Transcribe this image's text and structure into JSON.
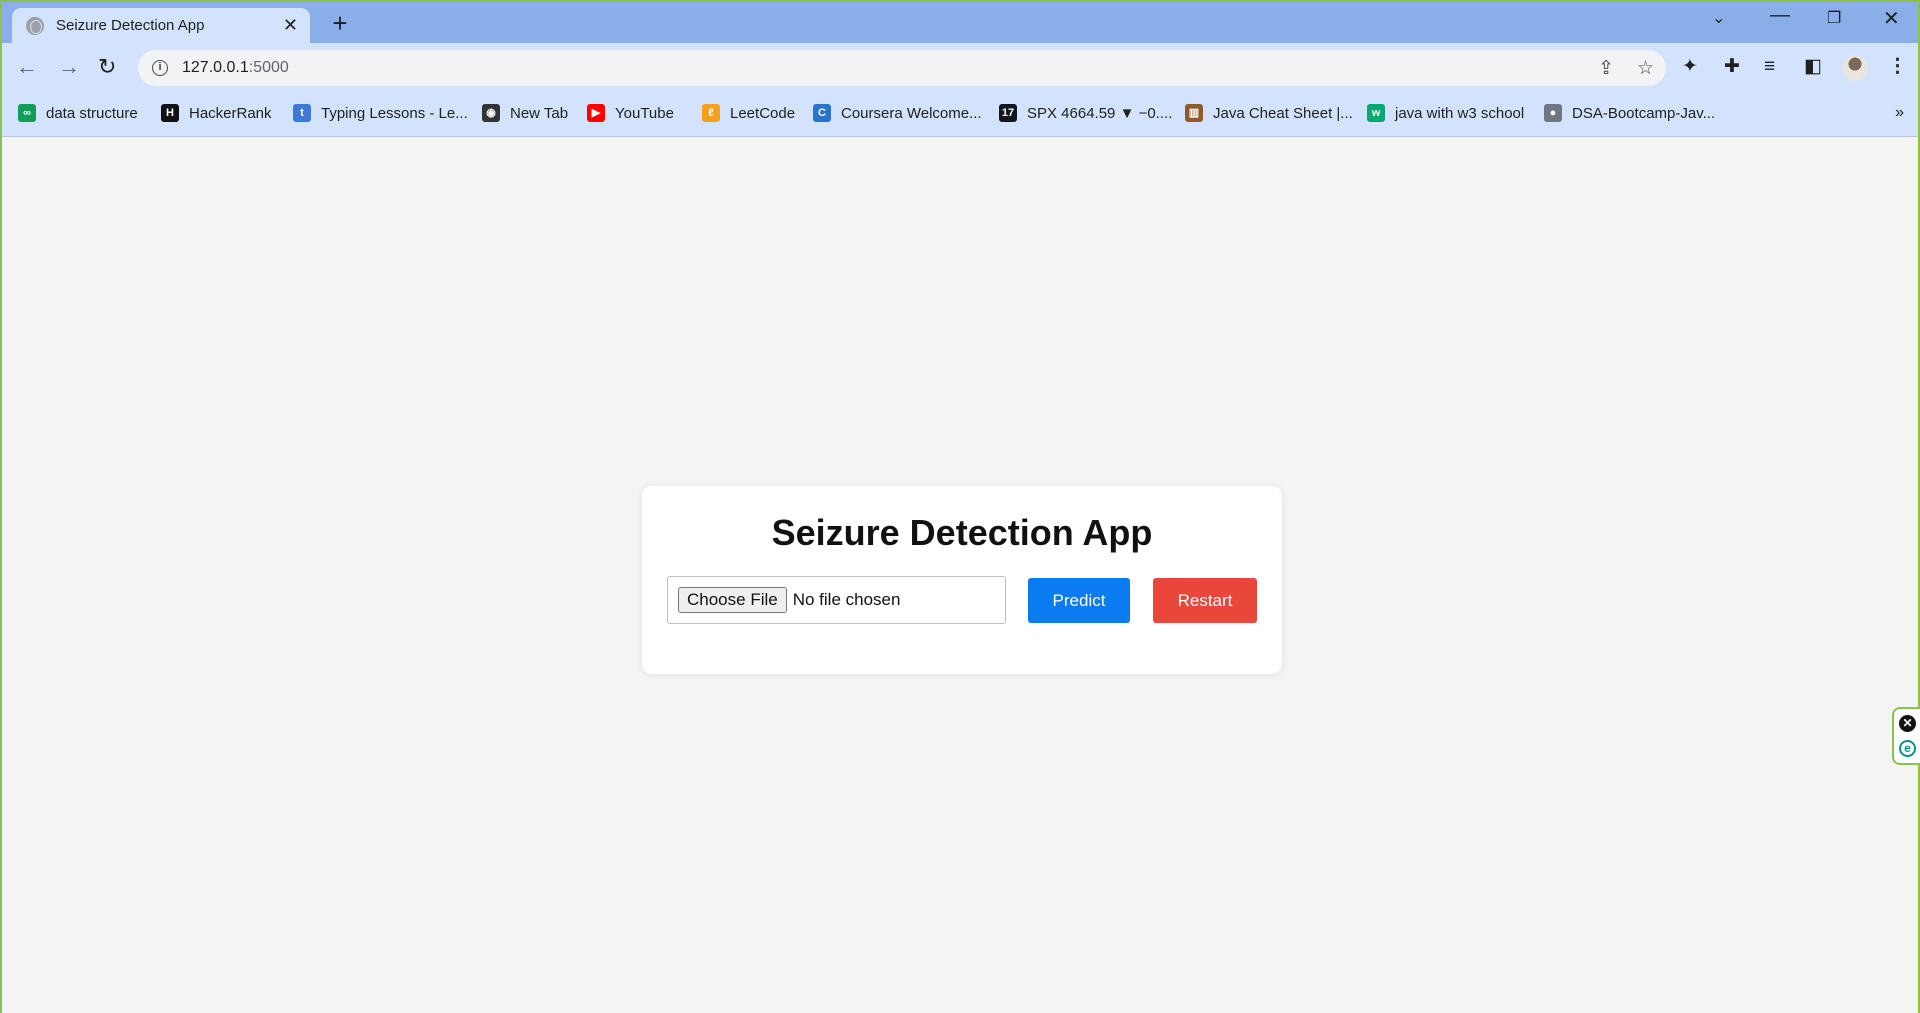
{
  "browser": {
    "tab": {
      "title": "Seizure Detection App",
      "close": "✕"
    },
    "new_tab": "+",
    "window": {
      "tab_search": "⌄",
      "minimize": "—",
      "maximize": "❐",
      "close": "✕"
    },
    "nav": {
      "back": "←",
      "forward": "→",
      "reload": "↻"
    },
    "address": {
      "host": "127.0.0.1",
      "port": ":5000",
      "info": "i"
    },
    "omnibox_icons": {
      "share": "⇪",
      "star": "☆"
    },
    "toolbar_icons": {
      "ext1": "✦",
      "ext2": "✚",
      "media": "≡",
      "side_panel": "◧",
      "menu": "⋮"
    },
    "bookmarks": [
      {
        "label": "data structure",
        "icon": "link-icon",
        "color": "#0f9d58",
        "glyph": "∞"
      },
      {
        "label": "HackerRank",
        "icon": "hackerrank-icon",
        "color": "#111111",
        "glyph": "H"
      },
      {
        "label": "Typing Lessons - Le...",
        "icon": "typing-icon",
        "color": "#3d7ad6",
        "glyph": "t"
      },
      {
        "label": "New Tab",
        "icon": "globe-icon",
        "color": "#333333",
        "glyph": "◉"
      },
      {
        "label": "YouTube",
        "icon": "youtube-icon",
        "color": "#ff0000",
        "glyph": "▶"
      },
      {
        "label": "LeetCode",
        "icon": "leetcode-icon",
        "color": "#f89f1b",
        "glyph": "ℓ"
      },
      {
        "label": "Coursera Welcome...",
        "icon": "coursera-icon",
        "color": "#2a73cc",
        "glyph": "C"
      },
      {
        "label": "SPX 4664.59 ▼ −0....",
        "icon": "tradingview-icon",
        "color": "#131722",
        "glyph": "17"
      },
      {
        "label": "Java Cheat Sheet |...",
        "icon": "cheatsheet-icon",
        "color": "#8e5a2b",
        "glyph": "▥"
      },
      {
        "label": "java with w3 school",
        "icon": "w3-icon",
        "color": "#04aa6d",
        "glyph": "w"
      },
      {
        "label": "DSA-Bootcamp-Jav...",
        "icon": "github-icon",
        "color": "#6e7681",
        "glyph": "●"
      }
    ],
    "bookmarks_more": "»"
  },
  "app": {
    "title": "Seizure Detection App",
    "choose_file_label": "Choose File",
    "file_status": "No file chosen",
    "predict_label": "Predict",
    "restart_label": "Restart"
  },
  "side_widget": {
    "close": "✕",
    "edge": "e"
  },
  "colors": {
    "predict": "#0a7bf0",
    "restart": "#e8473a",
    "background": "#f4f4f4",
    "browser_frame": "#d3e3fd"
  }
}
